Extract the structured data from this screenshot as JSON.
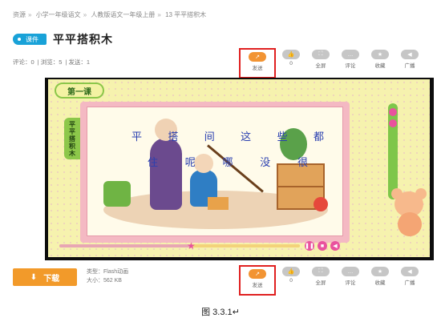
{
  "breadcrumb": [
    "资源",
    "小学一年级语文",
    "人教版语文一年级上册",
    "13 平平搭积木"
  ],
  "page": {
    "tag": "课件",
    "title": "平平搭积木",
    "stats": {
      "comments": "评论：0",
      "views": "浏览：5",
      "sends": "发送：1"
    }
  },
  "toolbar_top": [
    {
      "label": "发送",
      "icon": "send-icon",
      "count": ""
    },
    {
      "label": "0",
      "icon": "like-icon"
    },
    {
      "label": "全屏",
      "icon": "fullscreen-icon"
    },
    {
      "label": "评论",
      "icon": "comment-icon"
    },
    {
      "label": "收藏",
      "icon": "star-icon"
    },
    {
      "label": "广播",
      "icon": "broadcast-icon"
    }
  ],
  "player": {
    "lesson_badge": "第一课",
    "spine_title": "平平搭积木",
    "poem_line1": [
      "平",
      "搭",
      "间",
      "这",
      "些",
      "都"
    ],
    "poem_line2": [
      "住",
      "呢",
      "哪",
      "没",
      "很"
    ],
    "progress": 0.55
  },
  "download": {
    "label": "下载",
    "type": "类型：Flash动画",
    "size": "大小：562 KB"
  },
  "toolbar_bottom": [
    {
      "label": "发送",
      "icon": "send-icon"
    },
    {
      "label": "0",
      "icon": "like-icon"
    },
    {
      "label": "全屏",
      "icon": "fullscreen-icon"
    },
    {
      "label": "评论",
      "icon": "comment-icon"
    },
    {
      "label": "收藏",
      "icon": "star-icon"
    },
    {
      "label": "广播",
      "icon": "broadcast-icon"
    }
  ],
  "caption": "图 3.3.1↵",
  "colors": {
    "accent": "#19a2d8",
    "orange": "#f29a2a",
    "highlight": "#e02020"
  }
}
